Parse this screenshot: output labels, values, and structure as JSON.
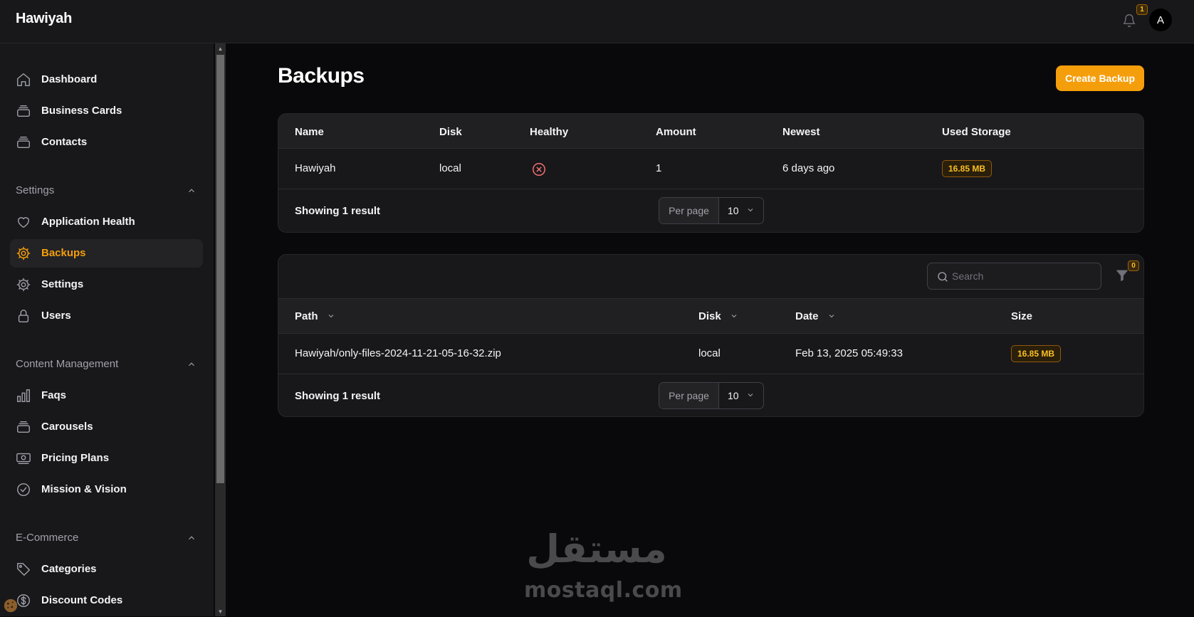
{
  "app": {
    "brand": "Hawiyah",
    "notification_count": "1",
    "avatar_initial": "A"
  },
  "sidebar": {
    "top_items": [
      {
        "label": "Dashboard",
        "icon": "home-icon"
      },
      {
        "label": "Business Cards",
        "icon": "stack-icon"
      },
      {
        "label": "Contacts",
        "icon": "stack-icon"
      }
    ],
    "groups": [
      {
        "label": "Settings",
        "items": [
          {
            "label": "Application Health",
            "icon": "heart-icon"
          },
          {
            "label": "Backups",
            "icon": "cog-icon",
            "active": true
          },
          {
            "label": "Settings",
            "icon": "cog-icon"
          },
          {
            "label": "Users",
            "icon": "lock-icon"
          }
        ]
      },
      {
        "label": "Content Management",
        "items": [
          {
            "label": "Faqs",
            "icon": "bar-chart-icon"
          },
          {
            "label": "Carousels",
            "icon": "stack-icon"
          },
          {
            "label": "Pricing Plans",
            "icon": "banknote-icon"
          },
          {
            "label": "Mission & Vision",
            "icon": "check-circle-icon"
          }
        ]
      },
      {
        "label": "E-Commerce",
        "items": [
          {
            "label": "Categories",
            "icon": "tag-icon"
          },
          {
            "label": "Discount Codes",
            "icon": "dollar-circle-icon"
          }
        ]
      }
    ]
  },
  "page": {
    "title": "Backups",
    "create_button": "Create Backup"
  },
  "destinations_table": {
    "columns": [
      "Name",
      "Disk",
      "Healthy",
      "Amount",
      "Newest",
      "Used Storage"
    ],
    "rows": [
      {
        "name": "Hawiyah",
        "disk": "local",
        "healthy": "false",
        "amount": "1",
        "newest": "6 days ago",
        "used_storage": "16.85 MB"
      }
    ],
    "footer": {
      "showing": "Showing 1 result",
      "per_page_label": "Per page",
      "per_page_value": "10"
    }
  },
  "backups_table": {
    "search_placeholder": "Search",
    "filter_count": "0",
    "columns": [
      "Path",
      "Disk",
      "Date",
      "Size"
    ],
    "rows": [
      {
        "path": "Hawiyah/only-files-2024-11-21-05-16-32.zip",
        "disk": "local",
        "date": "Feb 13, 2025 05:49:33",
        "size": "16.85 MB"
      }
    ],
    "footer": {
      "showing": "Showing 1 result",
      "per_page_label": "Per page",
      "per_page_value": "10"
    }
  },
  "watermark": {
    "arabic": "مستقل",
    "latin": "mostaql.com"
  },
  "colors": {
    "accent": "#f59e0b",
    "background": "#09090b",
    "surface": "#18181b",
    "danger": "#ef4444"
  }
}
